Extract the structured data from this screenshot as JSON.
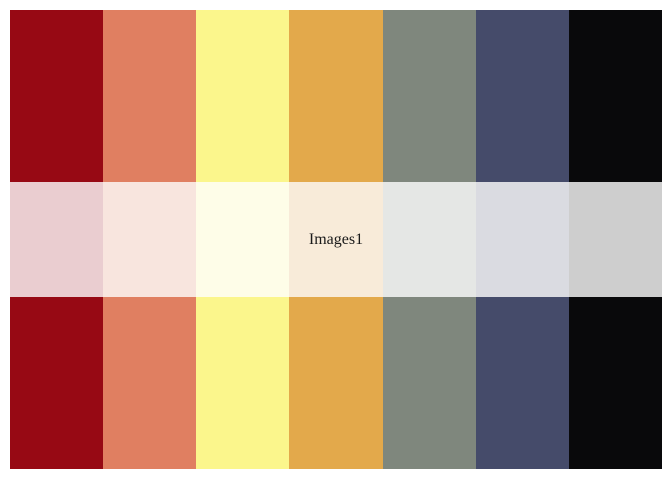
{
  "caption": "Images1",
  "palette": [
    {
      "color": "#970914",
      "tint": "#eacdd0"
    },
    {
      "color": "#e07f61",
      "tint": "#f8e5de"
    },
    {
      "color": "#fbf68c",
      "tint": "#fefde8"
    },
    {
      "color": "#e3a94b",
      "tint": "#f8ebd9"
    },
    {
      "color": "#7f877d",
      "tint": "#e5e7e5"
    },
    {
      "color": "#454b6a",
      "tint": "#dadbe1"
    },
    {
      "color": "#09090b",
      "tint": "#cecece"
    }
  ]
}
